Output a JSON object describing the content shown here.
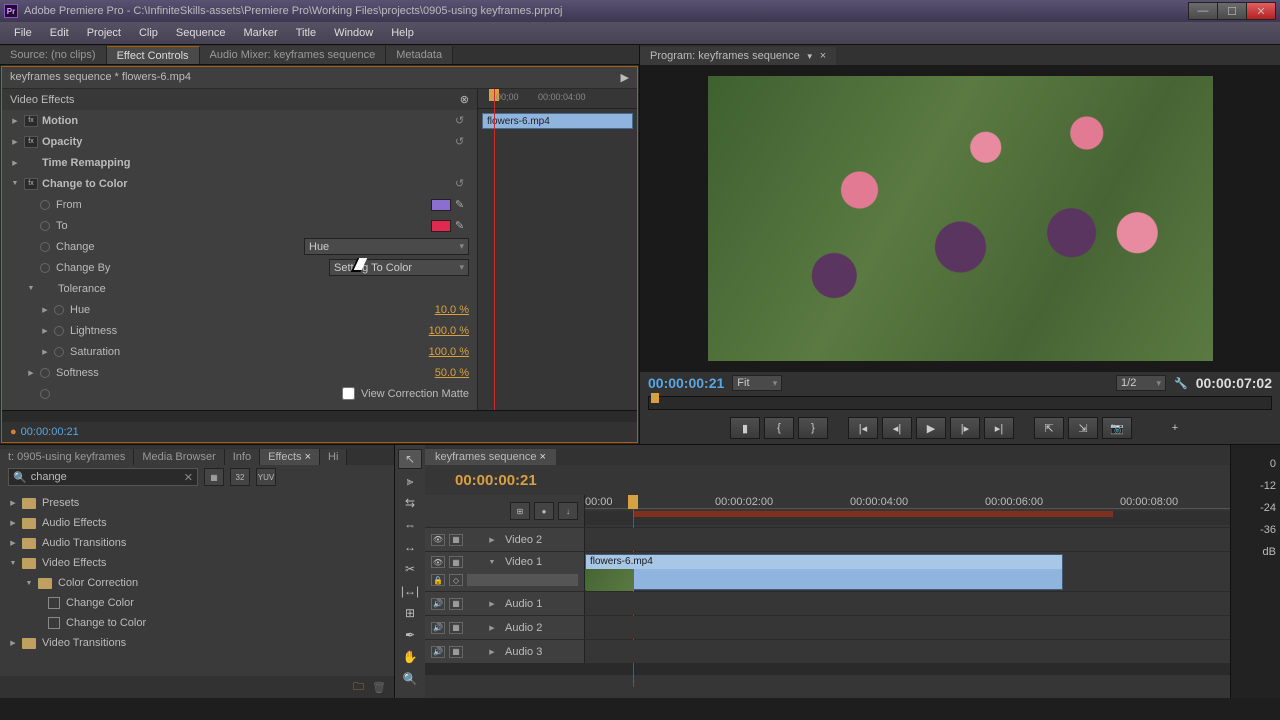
{
  "title": "Adobe Premiere Pro - C:\\InfiniteSkills-assets\\Premiere Pro\\Working Files\\projects\\0905-using keyframes.prproj",
  "menu": [
    "File",
    "Edit",
    "Project",
    "Clip",
    "Sequence",
    "Marker",
    "Title",
    "Window",
    "Help"
  ],
  "sourceTabs": {
    "source": "Source: (no clips)",
    "ec": "Effect Controls",
    "am": "Audio Mixer: keyframes sequence",
    "md": "Metadata"
  },
  "ec": {
    "path": "keyframes sequence * flowers-6.mp4",
    "sectionTitle": "Video Effects",
    "motion": "Motion",
    "opacity": "Opacity",
    "timerem": "Time Remapping",
    "ctc": "Change to Color",
    "from": "From",
    "to": "To",
    "change": "Change",
    "changeDD": "Hue",
    "changeBy": "Change By",
    "changeByDD": "Setting To Color",
    "tolerance": "Tolerance",
    "hue": "Hue",
    "hueV": "10.0 %",
    "light": "Lightness",
    "lightV": "100.0 %",
    "sat": "Saturation",
    "satV": "100.0 %",
    "soft": "Softness",
    "softV": "50.0 %",
    "viewMatteLabel": "View Correction Matte",
    "fromColor": "#8a6fd0",
    "toColor": "#e02850",
    "timecode": "00:00:00:21",
    "rulerEnd": "00:00:04:00",
    "clipName": "flowers-6.mp4"
  },
  "program": {
    "tab": "Program: keyframes sequence",
    "tcLeft": "00:00:00:21",
    "fit": "Fit",
    "zoom": "1/2",
    "tcRight": "00:00:07:02"
  },
  "project": {
    "tabs": [
      "t: 0905-using keyframes",
      "Media Browser",
      "Info",
      "Effects",
      "Hi"
    ],
    "search": "change",
    "tree": {
      "presets": "Presets",
      "ae": "Audio Effects",
      "at": "Audio Transitions",
      "ve": "Video Effects",
      "cc": "Color Correction",
      "chg": "Change Color",
      "ctc": "Change to Color",
      "vt": "Video Transitions"
    }
  },
  "timeline": {
    "tab": "keyframes sequence",
    "tc": "00:00:00:21",
    "ticks": [
      "00:00",
      "00:00:02:00",
      "00:00:04:00",
      "00:00:06:00",
      "00:00:08:00"
    ],
    "tracks": {
      "v2": "Video 2",
      "v1": "Video 1",
      "a1": "Audio 1",
      "a2": "Audio 2",
      "a3": "Audio 3"
    },
    "clip": "flowers-6.mp4"
  },
  "meters": [
    "0",
    "-12",
    "-24",
    "-36",
    "dB"
  ]
}
